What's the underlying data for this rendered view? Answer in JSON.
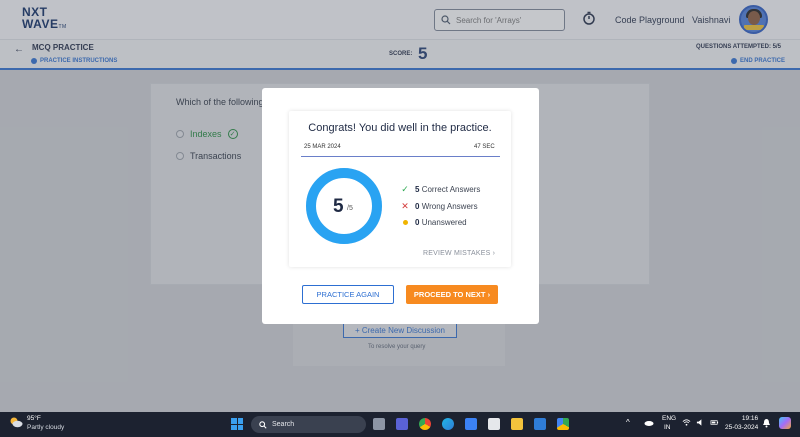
{
  "header": {
    "logo_text": "NXT WAVE",
    "logo_line1": "NXT",
    "logo_line2": "WAVE",
    "logo_tm": "TM",
    "search_placeholder": "Search for 'Arrays'",
    "nav_code_playground": "Code Playground",
    "user_name": "Vaishnavi"
  },
  "subheader": {
    "title": "MCQ PRACTICE",
    "instructions_label": "PRACTICE INSTRUCTIONS",
    "score_label": "SCORE:",
    "score_value": "5",
    "attempted_label": "QUESTIONS ATTEMPTED: 5/5",
    "end_practice_label": "END PRACTICE"
  },
  "question": {
    "text": "Which of the following",
    "options": [
      {
        "label": "Indexes",
        "correct": true
      },
      {
        "label": "Transactions",
        "correct": false
      }
    ]
  },
  "discussion": {
    "button_label": "+ Create New Discussion",
    "hint": "To resolve your query"
  },
  "modal": {
    "headline": "Congrats! You did well in the practice.",
    "date": "25 MAR 2024",
    "time_taken": "47 SEC",
    "score": "5",
    "total": "/5",
    "score_fraction": 1.0,
    "stats": [
      {
        "count": "5",
        "label": "Correct Answers"
      },
      {
        "count": "0",
        "label": "Wrong Answers"
      },
      {
        "count": "0",
        "label": "Unanswered"
      }
    ],
    "review_label": "REVIEW MISTAKES",
    "practice_again_label": "PRACTICE AGAIN",
    "proceed_label": "PROCEED TO NEXT",
    "colors": {
      "ring": "#29a3f2",
      "primary": "#2d6fd2",
      "accent": "#f78a20"
    }
  },
  "taskbar": {
    "temperature": "95°F",
    "condition": "Partly cloudy",
    "search_label": "Search",
    "lang_line1": "ENG",
    "lang_line2": "IN",
    "time": "19:16",
    "date": "25-03-2024"
  }
}
